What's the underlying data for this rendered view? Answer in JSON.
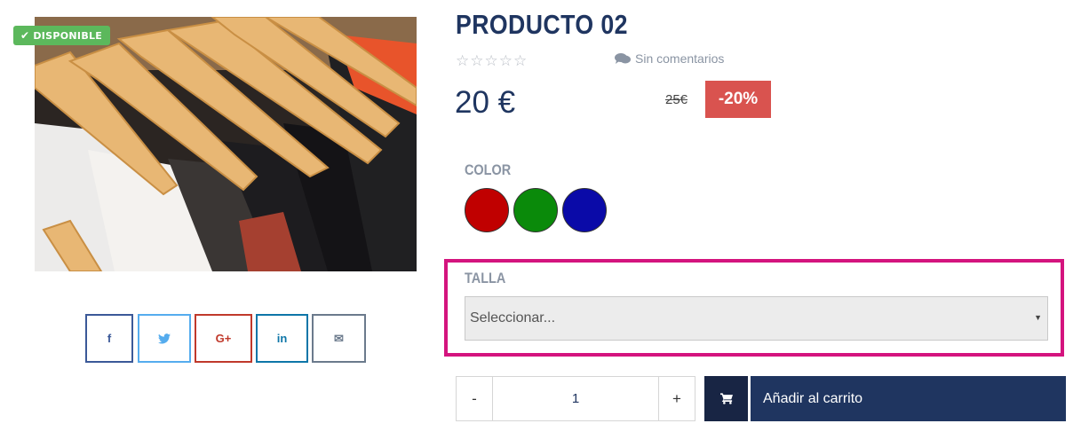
{
  "product": {
    "badge": "DISPONIBLE",
    "title": "PRODUCTO 02",
    "rating_stars": "☆☆☆☆☆",
    "comments_label": "Sin comentarios",
    "price": "20 €",
    "old_price": "25€",
    "discount": "-20%"
  },
  "share": {
    "facebook": "f",
    "twitter": "🐦",
    "google_plus": "G+",
    "linkedin": "in",
    "email": "✉"
  },
  "color": {
    "label": "COLOR",
    "swatches": [
      "#c00000",
      "#0a8a0a",
      "#0a0aa8"
    ]
  },
  "talla": {
    "label": "TALLA",
    "selected": "Seleccionar..."
  },
  "quantity": {
    "minus": "-",
    "value": "1",
    "plus": "+"
  },
  "cart": {
    "button_label": "Añadir al carrito"
  },
  "colors": {
    "primary": "#1f3560",
    "available": "#5cb85c",
    "discount": "#d9534f",
    "highlight": "#d4147e"
  }
}
